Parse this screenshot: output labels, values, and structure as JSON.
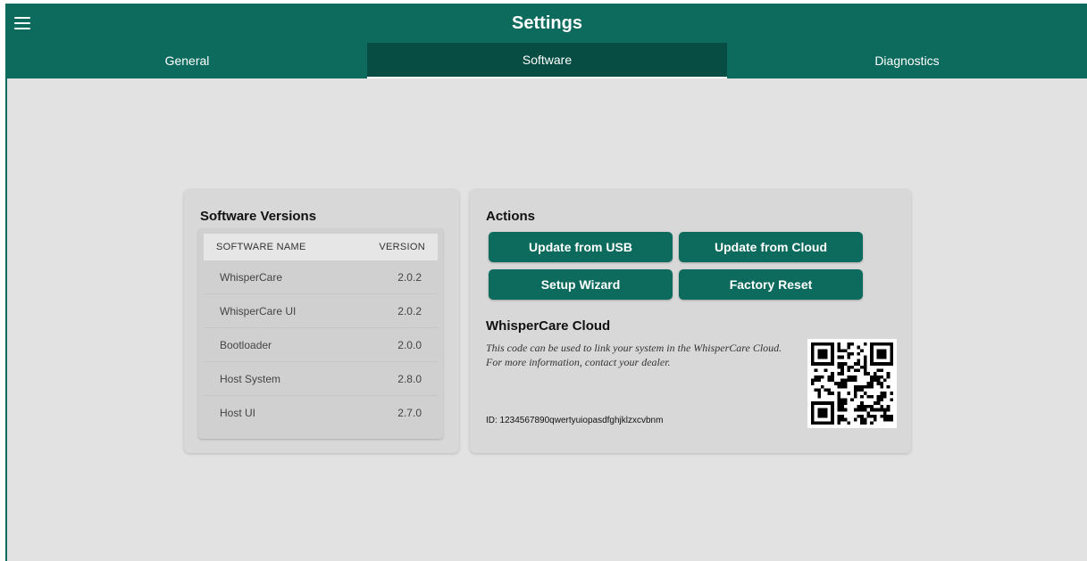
{
  "header": {
    "title": "Settings",
    "menu_icon": "hamburger-menu-icon"
  },
  "tabs": [
    {
      "label": "General",
      "active": false
    },
    {
      "label": "Software",
      "active": true
    },
    {
      "label": "Diagnostics",
      "active": false
    }
  ],
  "versions": {
    "title": "Software Versions",
    "columns": [
      "SOFTWARE NAME",
      "VERSION"
    ],
    "rows": [
      {
        "name": "WhisperCare",
        "version": "2.0.2"
      },
      {
        "name": "WhisperCare UI",
        "version": "2.0.2"
      },
      {
        "name": "Bootloader",
        "version": "2.0.0"
      },
      {
        "name": "Host System",
        "version": "2.8.0"
      },
      {
        "name": "Host UI",
        "version": "2.7.0"
      }
    ]
  },
  "actions": {
    "title": "Actions",
    "update_usb": "Update from USB",
    "update_cloud": "Update from Cloud",
    "setup_wizard": "Setup Wizard",
    "factory_reset": "Factory Reset"
  },
  "cloud": {
    "title": "WhisperCare Cloud",
    "description_line1": "This code can be used to link your system in the WhisperCare Cloud.",
    "description_line2": "For more information, contact your dealer.",
    "id_text": "ID: 1234567890qwertyuiopasdfghjklzxcvbnm",
    "qr_icon": "qr-code-icon"
  },
  "colors": {
    "primary": "#0d6b5e",
    "primary_dark": "#074d43",
    "background": "#e2e2e2",
    "card": "#d8d8d8"
  }
}
